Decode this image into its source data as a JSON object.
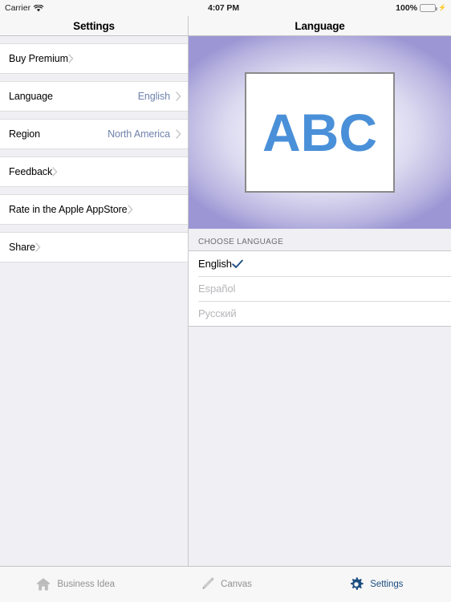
{
  "statusbar": {
    "carrier": "Carrier",
    "wifi_icon": "wifi-icon",
    "time": "4:07 PM",
    "battery_percent": "100%",
    "battery_icon": "battery-full-icon",
    "charging_icon": "charging-bolt-icon"
  },
  "master": {
    "title": "Settings",
    "chevron_icon": "chevron-right-icon",
    "rows": [
      {
        "label": "Buy Premium",
        "value": ""
      },
      {
        "label": "Language",
        "value": "English"
      },
      {
        "label": "Region",
        "value": "North America"
      },
      {
        "label": "Feedback",
        "value": ""
      },
      {
        "label": "Rate in the Apple AppStore",
        "value": ""
      },
      {
        "label": "Share",
        "value": ""
      }
    ]
  },
  "detail": {
    "title": "Language",
    "hero": {
      "card_text": "ABC",
      "text_color": "#4a90d9",
      "background_color": "#9c97d4"
    },
    "section_header": "CHOOSE LANGUAGE",
    "check_icon": "checkmark-icon",
    "languages": [
      {
        "label": "English",
        "selected": true,
        "enabled": true
      },
      {
        "label": "Español",
        "selected": false,
        "enabled": false
      },
      {
        "label": "Русский",
        "selected": false,
        "enabled": false
      }
    ]
  },
  "tabbar": {
    "active_color": "#1c4e80",
    "inactive_color": "#929292",
    "tabs": [
      {
        "label": "Business Idea",
        "icon": "home-icon",
        "active": false
      },
      {
        "label": "Canvas",
        "icon": "pencil-icon",
        "active": false
      },
      {
        "label": "Settings",
        "icon": "gear-icon",
        "active": true
      }
    ]
  }
}
